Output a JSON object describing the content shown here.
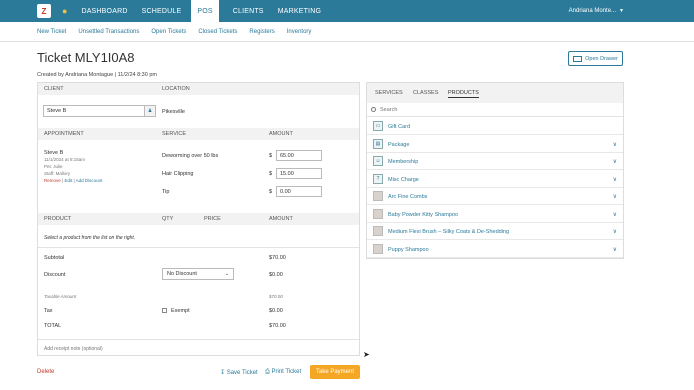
{
  "topnav": {
    "logo": "Z",
    "tabs": [
      "DASHBOARD",
      "SCHEDULE",
      "POS",
      "CLIENTS",
      "MARKETING"
    ],
    "active_tab": "POS",
    "user": "Andriana Monte..."
  },
  "subnav": [
    "New Ticket",
    "Unsettled Transactions",
    "Open Tickets",
    "Closed Tickets",
    "Registers",
    "Inventory"
  ],
  "ticket": {
    "title": "Ticket MLY1I0A8",
    "created": "Created by Andriana Montague  |  11/2/24 8:30 pm",
    "open_drawer": "Open Drawer"
  },
  "client_section": {
    "client_header": "CLIENT",
    "location_header": "LOCATION",
    "client_value": "Steve B",
    "location_value": "Pikesville"
  },
  "appointment_section": {
    "headers": [
      "APPOINTMENT",
      "SERVICE",
      "AMOUNT"
    ],
    "client_name": "Steve B",
    "date": "11/1/2024 at 8:15am",
    "pet": "Pet: Julie",
    "staff": "Staff: Mallory",
    "actions": [
      "Remove",
      "Edit",
      "Add Discount"
    ],
    "services": [
      {
        "name": "Deworming over 50 lbs",
        "currency": "$",
        "amount": "65.00"
      },
      {
        "name": "Hair Clipping",
        "currency": "$",
        "amount": "15.00"
      },
      {
        "name": "Tip",
        "currency": "$",
        "amount": "0.00"
      }
    ]
  },
  "product_section": {
    "headers": [
      "PRODUCT",
      "QTY",
      "PRICE",
      "AMOUNT"
    ],
    "empty_message": "Select a product from the list on the right."
  },
  "totals": {
    "subtotal_label": "Subtotal",
    "subtotal": "$70.00",
    "discount_label": "Discount",
    "discount_select": "No Discount",
    "discount": "$0.00",
    "taxable_label": "Taxable Amount",
    "taxable": "$70.00",
    "tax_label": "Tax",
    "exempt_label": "Exempt",
    "tax": "$0.00",
    "total_label": "TOTAL",
    "total": "$70.00"
  },
  "receipt_note_placeholder": "Add receipt note (optional)",
  "footer": {
    "delete": "Delete",
    "save": "Save Ticket",
    "print": "Print Ticket",
    "pay": "Take Payment"
  },
  "catalog": {
    "tabs": [
      "SERVICES",
      "CLASSES",
      "PRODUCTS"
    ],
    "active_tab": "PRODUCTS",
    "search_placeholder": "Search",
    "items": [
      {
        "name": "Gift Card",
        "icon": "gift-card-icon",
        "glyph": "▭",
        "expandable": false
      },
      {
        "name": "Package",
        "icon": "package-icon",
        "glyph": "▤",
        "expandable": true
      },
      {
        "name": "Membership",
        "icon": "membership-icon",
        "glyph": "☺",
        "expandable": true
      },
      {
        "name": "Misc Charge",
        "icon": "question-icon",
        "glyph": "?",
        "expandable": true
      },
      {
        "name": "Arc Fine Combs",
        "icon": "product-photo-icon",
        "glyph": "",
        "expandable": true
      },
      {
        "name": "Baby Powder Kitty Shampoo",
        "icon": "product-photo-icon",
        "glyph": "",
        "expandable": true
      },
      {
        "name": "Medium Flexi Brush – Silky Coats & De-Shedding",
        "icon": "product-photo-icon",
        "glyph": "",
        "expandable": true
      },
      {
        "name": "Puppy Shampoo",
        "icon": "product-photo-icon",
        "glyph": "",
        "expandable": true
      }
    ]
  },
  "colors": {
    "brand": "#2b7a99",
    "pay_button": "#f5a623",
    "delete": "#c0392b"
  }
}
